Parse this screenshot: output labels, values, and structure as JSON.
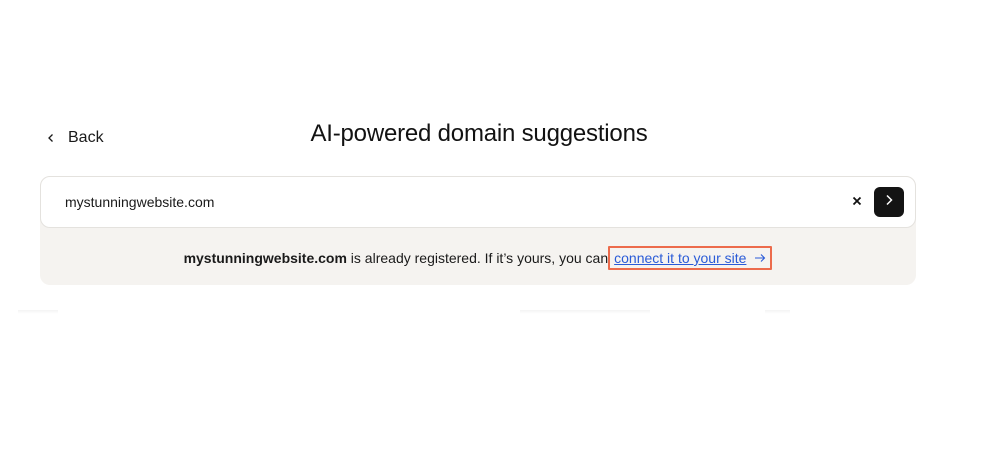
{
  "header": {
    "back_label": "Back",
    "title": "AI-powered domain suggestions"
  },
  "search": {
    "value": "mystunningwebsite.com",
    "clear_icon": "close-icon",
    "submit_icon": "chevron-right-icon"
  },
  "notice": {
    "domain": "mystunningwebsite.com",
    "text": " is already registered. If it’s yours, you can",
    "link_label": "connect it to your site",
    "link_icon": "arrow-right-icon"
  },
  "colors": {
    "panel_bg": "#f5f3f0",
    "link": "#2a5bd7",
    "highlight_border": "#ec6b4c",
    "submit_button": "#141414"
  }
}
